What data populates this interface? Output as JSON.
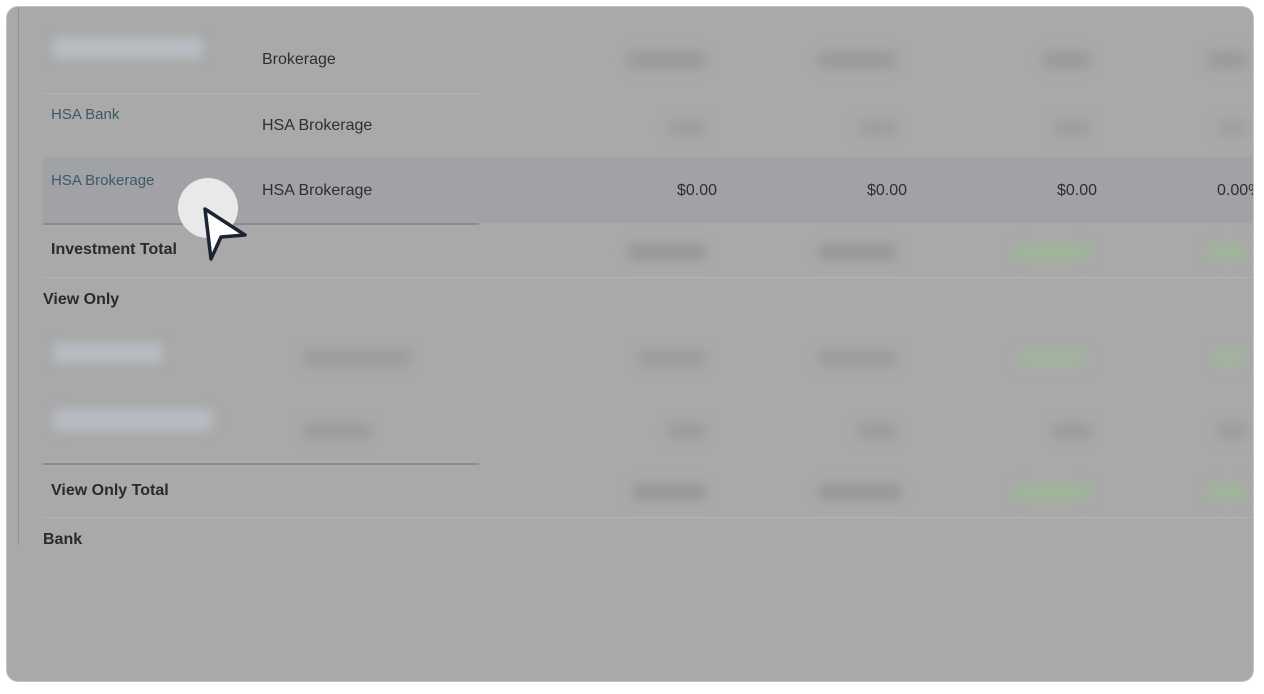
{
  "rows": {
    "r1": {
      "type": "Brokerage"
    },
    "r2": {
      "name": "HSA Bank",
      "type": "HSA Brokerage"
    },
    "r3": {
      "name": "HSA Brokerage",
      "type": "HSA Brokerage",
      "v1": "$0.00",
      "v2": "$0.00",
      "v3": "$0.00",
      "v4": "0.00%"
    }
  },
  "totals": {
    "investment": "Investment Total",
    "view_only": "View Only Total"
  },
  "sections": {
    "view_only": "View Only",
    "bank": "Bank"
  },
  "colors": {
    "overlay": "#a9a9a9",
    "highlight_row": "#a1a2a5",
    "link": "#3e5868"
  },
  "icons": {
    "cursor": "pointer-cursor-icon"
  }
}
